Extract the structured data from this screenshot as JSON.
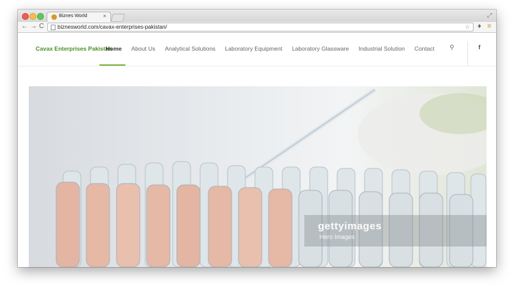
{
  "browser": {
    "tab_title": "Biznes World",
    "tab_close": "×",
    "url": "biznesworld.com/cavax-enterprises-pakistan/",
    "nav": {
      "back": "←",
      "forward": "→",
      "reload": "C"
    },
    "icons": {
      "bookmark": "☆",
      "extension": "♦",
      "menu": "≡"
    },
    "resize": "⤢"
  },
  "site": {
    "brand": "Cavax Enterprises Pakistan",
    "menu": [
      {
        "label": "Home",
        "active": true
      },
      {
        "label": "About Us",
        "active": false
      },
      {
        "label": "Analytical Solutions",
        "active": false
      },
      {
        "label": "Laboratory Equipment",
        "active": false
      },
      {
        "label": "Laboratory Glassware",
        "active": false
      },
      {
        "label": "Industrial Solution",
        "active": false
      },
      {
        "label": "Contact",
        "active": false
      }
    ],
    "search_icon": "⚲",
    "facebook_icon": "f"
  },
  "hero": {
    "watermark": "gettyimages",
    "credit": "Hero Images",
    "colors": {
      "liquid": "#e6b8a6",
      "glass": "#c9d2d8",
      "background": "#e7eaed",
      "accent": "#7cb342"
    }
  }
}
